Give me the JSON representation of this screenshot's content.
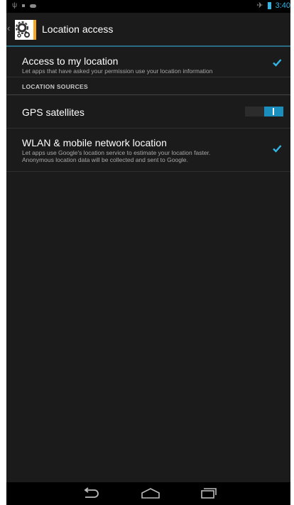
{
  "status_bar": {
    "time": "3:40",
    "icons": [
      "usb-icon",
      "notification-icon",
      "cloud-icon",
      "airplane-mode-icon",
      "battery-icon"
    ]
  },
  "action_bar": {
    "title": "Location access",
    "icon": "settings-gears-icon",
    "up_icon": "chevron-left-icon"
  },
  "settings": {
    "access": {
      "title": "Access to my location",
      "summary": "Let apps that have asked your permission use your location information",
      "checked": true
    },
    "section_header": "LOCATION SOURCES",
    "gps": {
      "title": "GPS satellites",
      "state": "on"
    },
    "wlan": {
      "title": "WLAN & mobile network location",
      "summary_line1": "Let apps use Google's location service to estimate your location faster.",
      "summary_line2": "Anonymous location data will be collected and sent to Google.",
      "checked": true
    }
  },
  "nav_bar": {
    "buttons": [
      "back-icon",
      "home-icon",
      "recent-apps-icon"
    ]
  },
  "colors": {
    "accent": "#33b5e5",
    "toggle_on": "#1a8fbd",
    "background": "#1b1b1b"
  }
}
